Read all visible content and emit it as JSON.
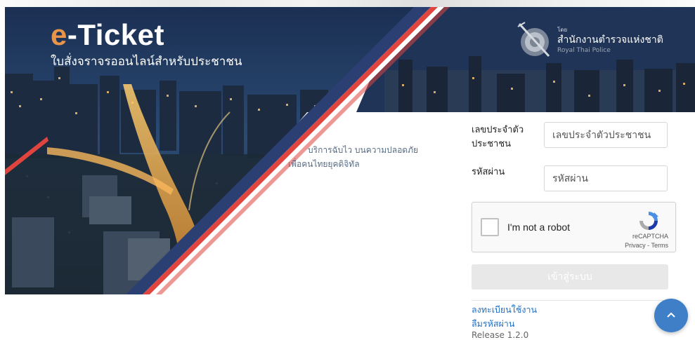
{
  "brand": {
    "title_e": "e",
    "title_rest": "-Ticket",
    "subtitle": "ใบสั่งจราจรออนไลน์สำหรับประชาชน"
  },
  "police": {
    "small": "โดย",
    "name_th": "สำนักงานตำรวจแห่งชาติ",
    "name_en": "Royal Thai Police"
  },
  "tagline": {
    "line1": "บริการฉับไว บนความปลอดภัย",
    "line2": "เพื่อคนไทยยุคดิจิทัล"
  },
  "form": {
    "id_label_line1": "เลขประจำตัว",
    "id_label_line2": "ประชาชน",
    "id_placeholder": "เลขประจำตัวประชาชน",
    "id_value": "",
    "password_label": "รหัสผ่าน",
    "password_placeholder": "รหัสผ่าน",
    "password_value": "",
    "login_button": "เข้าสู่ระบบ",
    "register_link": "ลงทะเบียนใช้งาน",
    "forgot_link": "ลืมรหัสผ่าน",
    "release": "Release 1.2.0"
  },
  "recaptcha": {
    "label": "I'm not a robot",
    "brand": "reCAPTCHA",
    "privacy": "Privacy",
    "separator": " - ",
    "terms": "Terms",
    "checked": false
  },
  "icons": {
    "scroll_top": "chevron-up-icon",
    "seal": "police-seal-icon",
    "recaptcha_logo": "recaptcha-logo-icon"
  },
  "colors": {
    "accent_orange": "#e8954a",
    "link_blue": "#1f6fc6",
    "scroll_button": "#3e7fc7",
    "stripe_red": "#e0443f",
    "stripe_navy": "#2b3f73"
  }
}
